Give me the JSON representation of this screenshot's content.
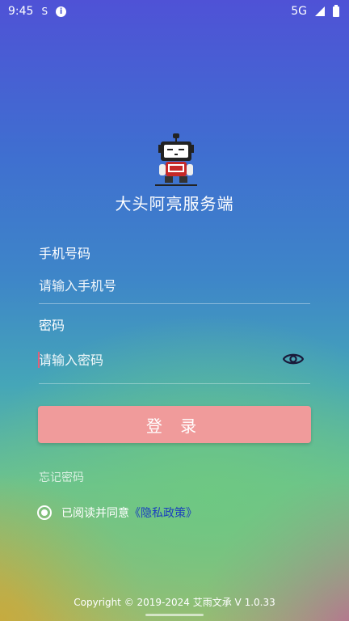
{
  "status_bar": {
    "time": "9:45",
    "network": "5G",
    "icons": [
      "sim-icon",
      "info-icon",
      "signal-icon",
      "battery-icon"
    ]
  },
  "app": {
    "title": "大头阿亮服务端",
    "logo_icon": "robot-mascot-icon"
  },
  "form": {
    "phone_label": "手机号码",
    "phone_placeholder": "请输入手机号",
    "phone_value": "",
    "password_label": "密码",
    "password_placeholder": "请输入密码",
    "password_value": "",
    "eye_icon": "eye-icon",
    "login_label": "登 录",
    "forgot_label": "忘记密码",
    "agree_text": "已阅读并同意",
    "policy_link": "《隐私政策》"
  },
  "footer": {
    "copyright": "Copyright © 2019-2024 艾雨文承 V 1.0.33"
  },
  "colors": {
    "login_button": "#f09b9b",
    "policy_link": "#1a3fbf",
    "cursor": "#e0607a"
  }
}
